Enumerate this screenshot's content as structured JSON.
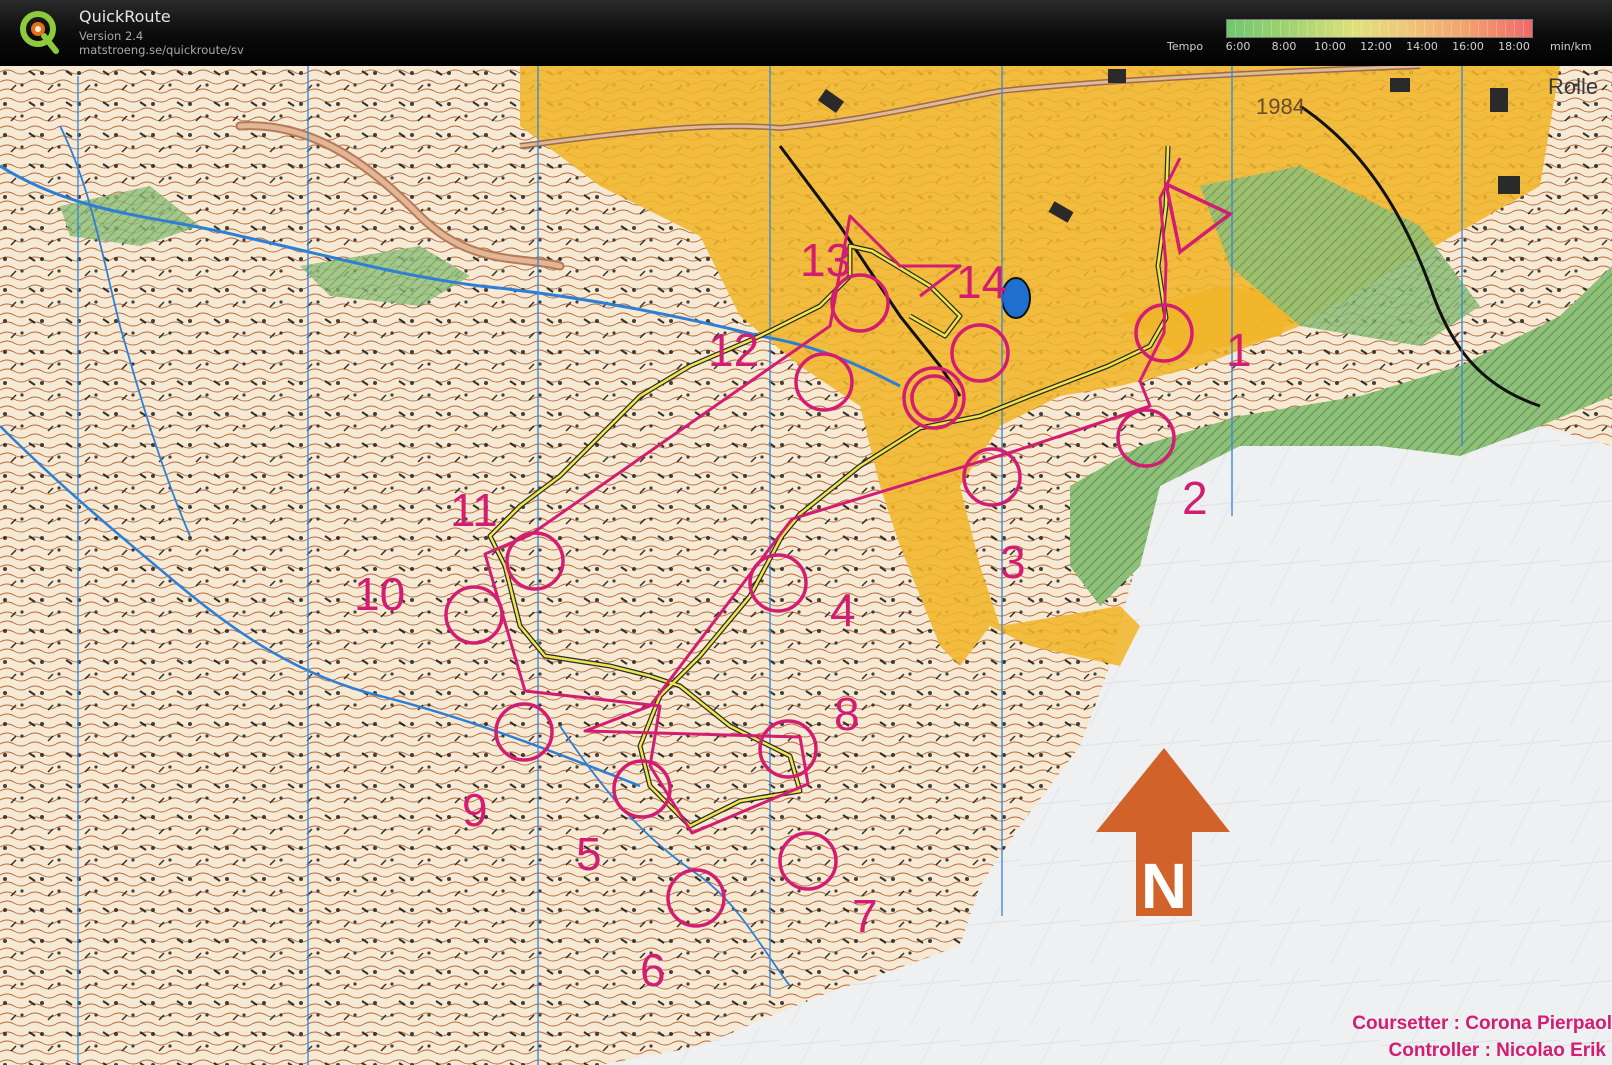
{
  "app": {
    "name": "QuickRoute",
    "version": "Version 2.4",
    "url": "matstroeng.se/quickroute/sv"
  },
  "tempo_legend": {
    "label": "Tempo",
    "ticks": [
      "6:00",
      "8:00",
      "10:00",
      "12:00",
      "14:00",
      "16:00",
      "18:00"
    ],
    "unit": "min/km"
  },
  "map": {
    "year_label": "1984",
    "place_label": "Rolle",
    "north_label": "N",
    "controls": [
      "1",
      "2",
      "3",
      "4",
      "5",
      "6",
      "7",
      "8",
      "9",
      "10",
      "11",
      "12",
      "13",
      "14"
    ],
    "credits": {
      "coursetter": "Coursetter : Corona Pierpaol",
      "controller": "Controller : Nicolao Erik"
    }
  },
  "colors": {
    "course": "#d21d73",
    "route": "#f0e84a",
    "water": "#2d7fd6",
    "arrow": "#d0622a"
  }
}
